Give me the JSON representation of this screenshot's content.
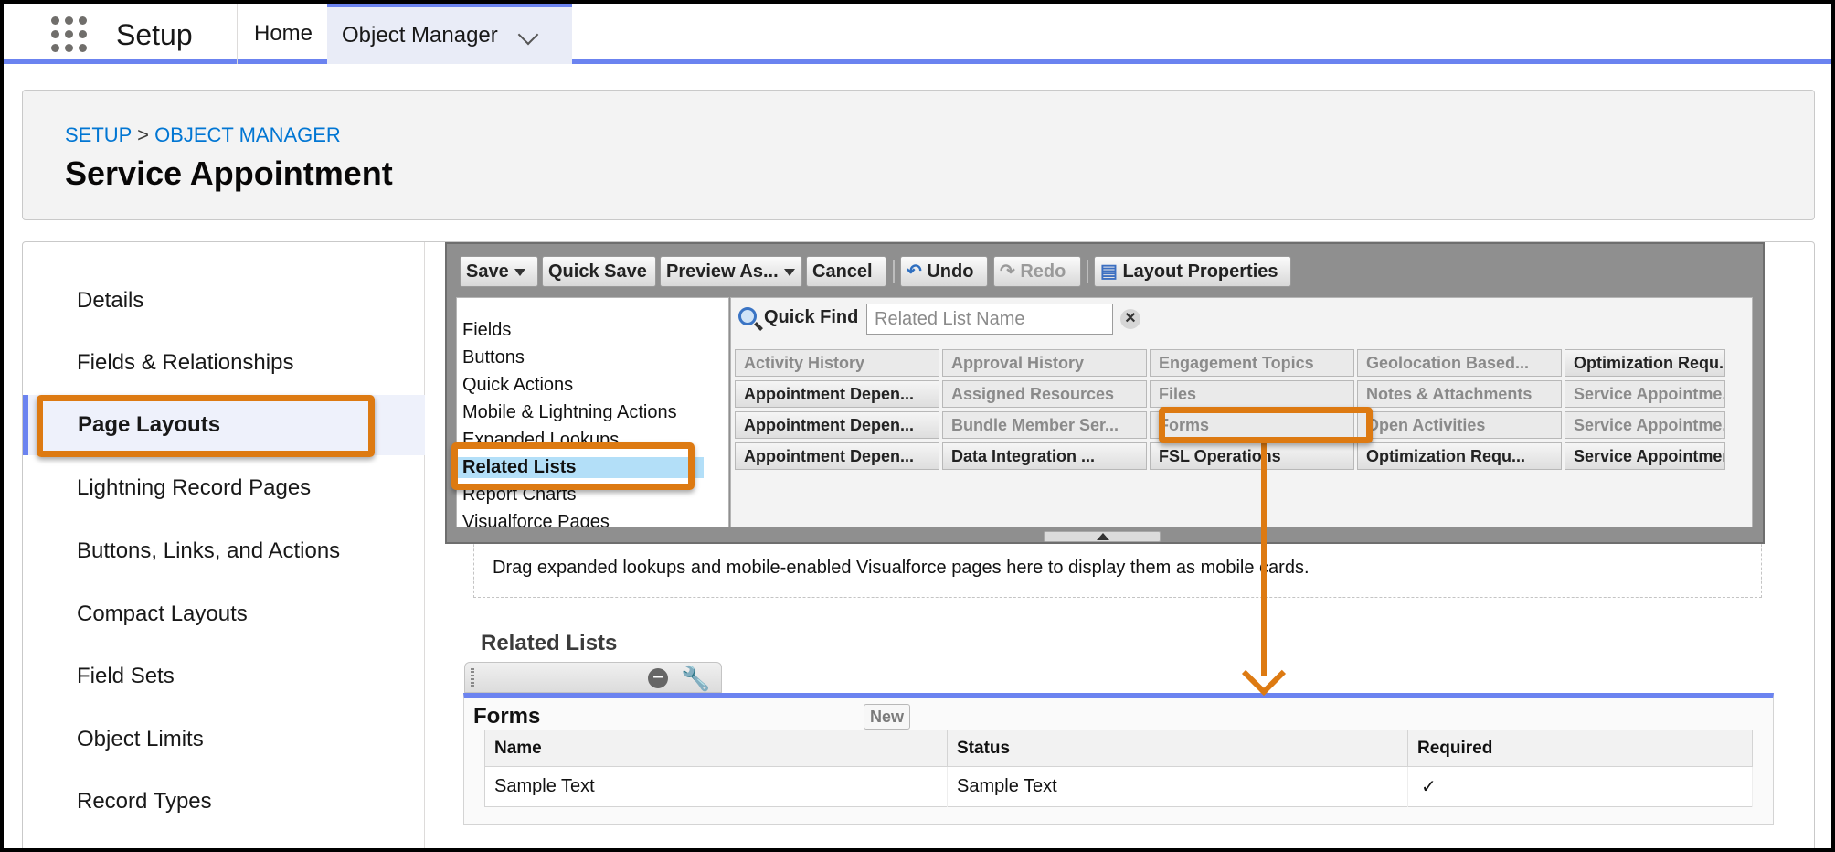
{
  "topbar": {
    "app_name": "Setup",
    "nav_home": "Home",
    "nav_object_manager": "Object Manager"
  },
  "header": {
    "breadcrumb": [
      "SETUP",
      "OBJECT MANAGER"
    ],
    "breadcrumb_sep": ">",
    "title": "Service Appointment"
  },
  "sidebar": {
    "items": [
      {
        "label": "Details"
      },
      {
        "label": "Fields & Relationships"
      },
      {
        "label": "Page Layouts",
        "active": true
      },
      {
        "label": "Lightning Record Pages"
      },
      {
        "label": "Buttons, Links, and Actions"
      },
      {
        "label": "Compact Layouts"
      },
      {
        "label": "Field Sets"
      },
      {
        "label": "Object Limits"
      },
      {
        "label": "Record Types"
      }
    ]
  },
  "toolbar": {
    "save": "Save",
    "quick_save": "Quick Save",
    "preview_as": "Preview As...",
    "cancel": "Cancel",
    "undo": "Undo",
    "redo": "Redo",
    "layout_properties": "Layout Properties"
  },
  "palette": {
    "categories": [
      "Fields",
      "Buttons",
      "Quick Actions",
      "Mobile & Lightning Actions",
      "Expanded Lookups",
      "Related Lists",
      "Report Charts",
      "Visualforce Pages"
    ],
    "selected_category": "Related Lists",
    "quick_find_label": "Quick Find",
    "quick_find_placeholder": "Related List Name",
    "clear_symbol": "✕",
    "items": [
      {
        "label": "Activity History",
        "used": true
      },
      {
        "label": "Approval History",
        "used": true
      },
      {
        "label": "Engagement Topics",
        "used": true
      },
      {
        "label": "Geolocation Based...",
        "used": true
      },
      {
        "label": "Optimization Requ...",
        "used": false
      },
      {
        "label": "Appointment Depen...",
        "used": false
      },
      {
        "label": "Assigned Resources",
        "used": true
      },
      {
        "label": "Files",
        "used": true
      },
      {
        "label": "Notes & Attachments",
        "used": true
      },
      {
        "label": "Service Appointme...",
        "used": true
      },
      {
        "label": "Appointment Depen...",
        "used": false
      },
      {
        "label": "Bundle Member Ser...",
        "used": true
      },
      {
        "label": "Forms",
        "used": true
      },
      {
        "label": "Open Activities",
        "used": true
      },
      {
        "label": "Service Appointme...",
        "used": true
      },
      {
        "label": "Appointment Depen...",
        "used": false
      },
      {
        "label": "Data Integration ...",
        "used": false
      },
      {
        "label": "FSL Operations",
        "used": false
      },
      {
        "label": "Optimization Requ...",
        "used": false
      },
      {
        "label": "Service Appointmen",
        "used": false
      }
    ]
  },
  "canvas": {
    "drop_hint": "Drag expanded lookups and mobile-enabled Visualforce pages here to display them as mobile cards.",
    "related_lists_heading": "Related Lists",
    "related_list": {
      "title": "Forms",
      "new_button": "New",
      "columns": [
        "Name",
        "Status",
        "Required"
      ],
      "rows": [
        {
          "name": "Sample Text",
          "status": "Sample Text",
          "required": "✓"
        }
      ]
    }
  },
  "colors": {
    "accent": "#6b83f0",
    "highlight": "#dd7a12",
    "link": "#0176d3"
  }
}
